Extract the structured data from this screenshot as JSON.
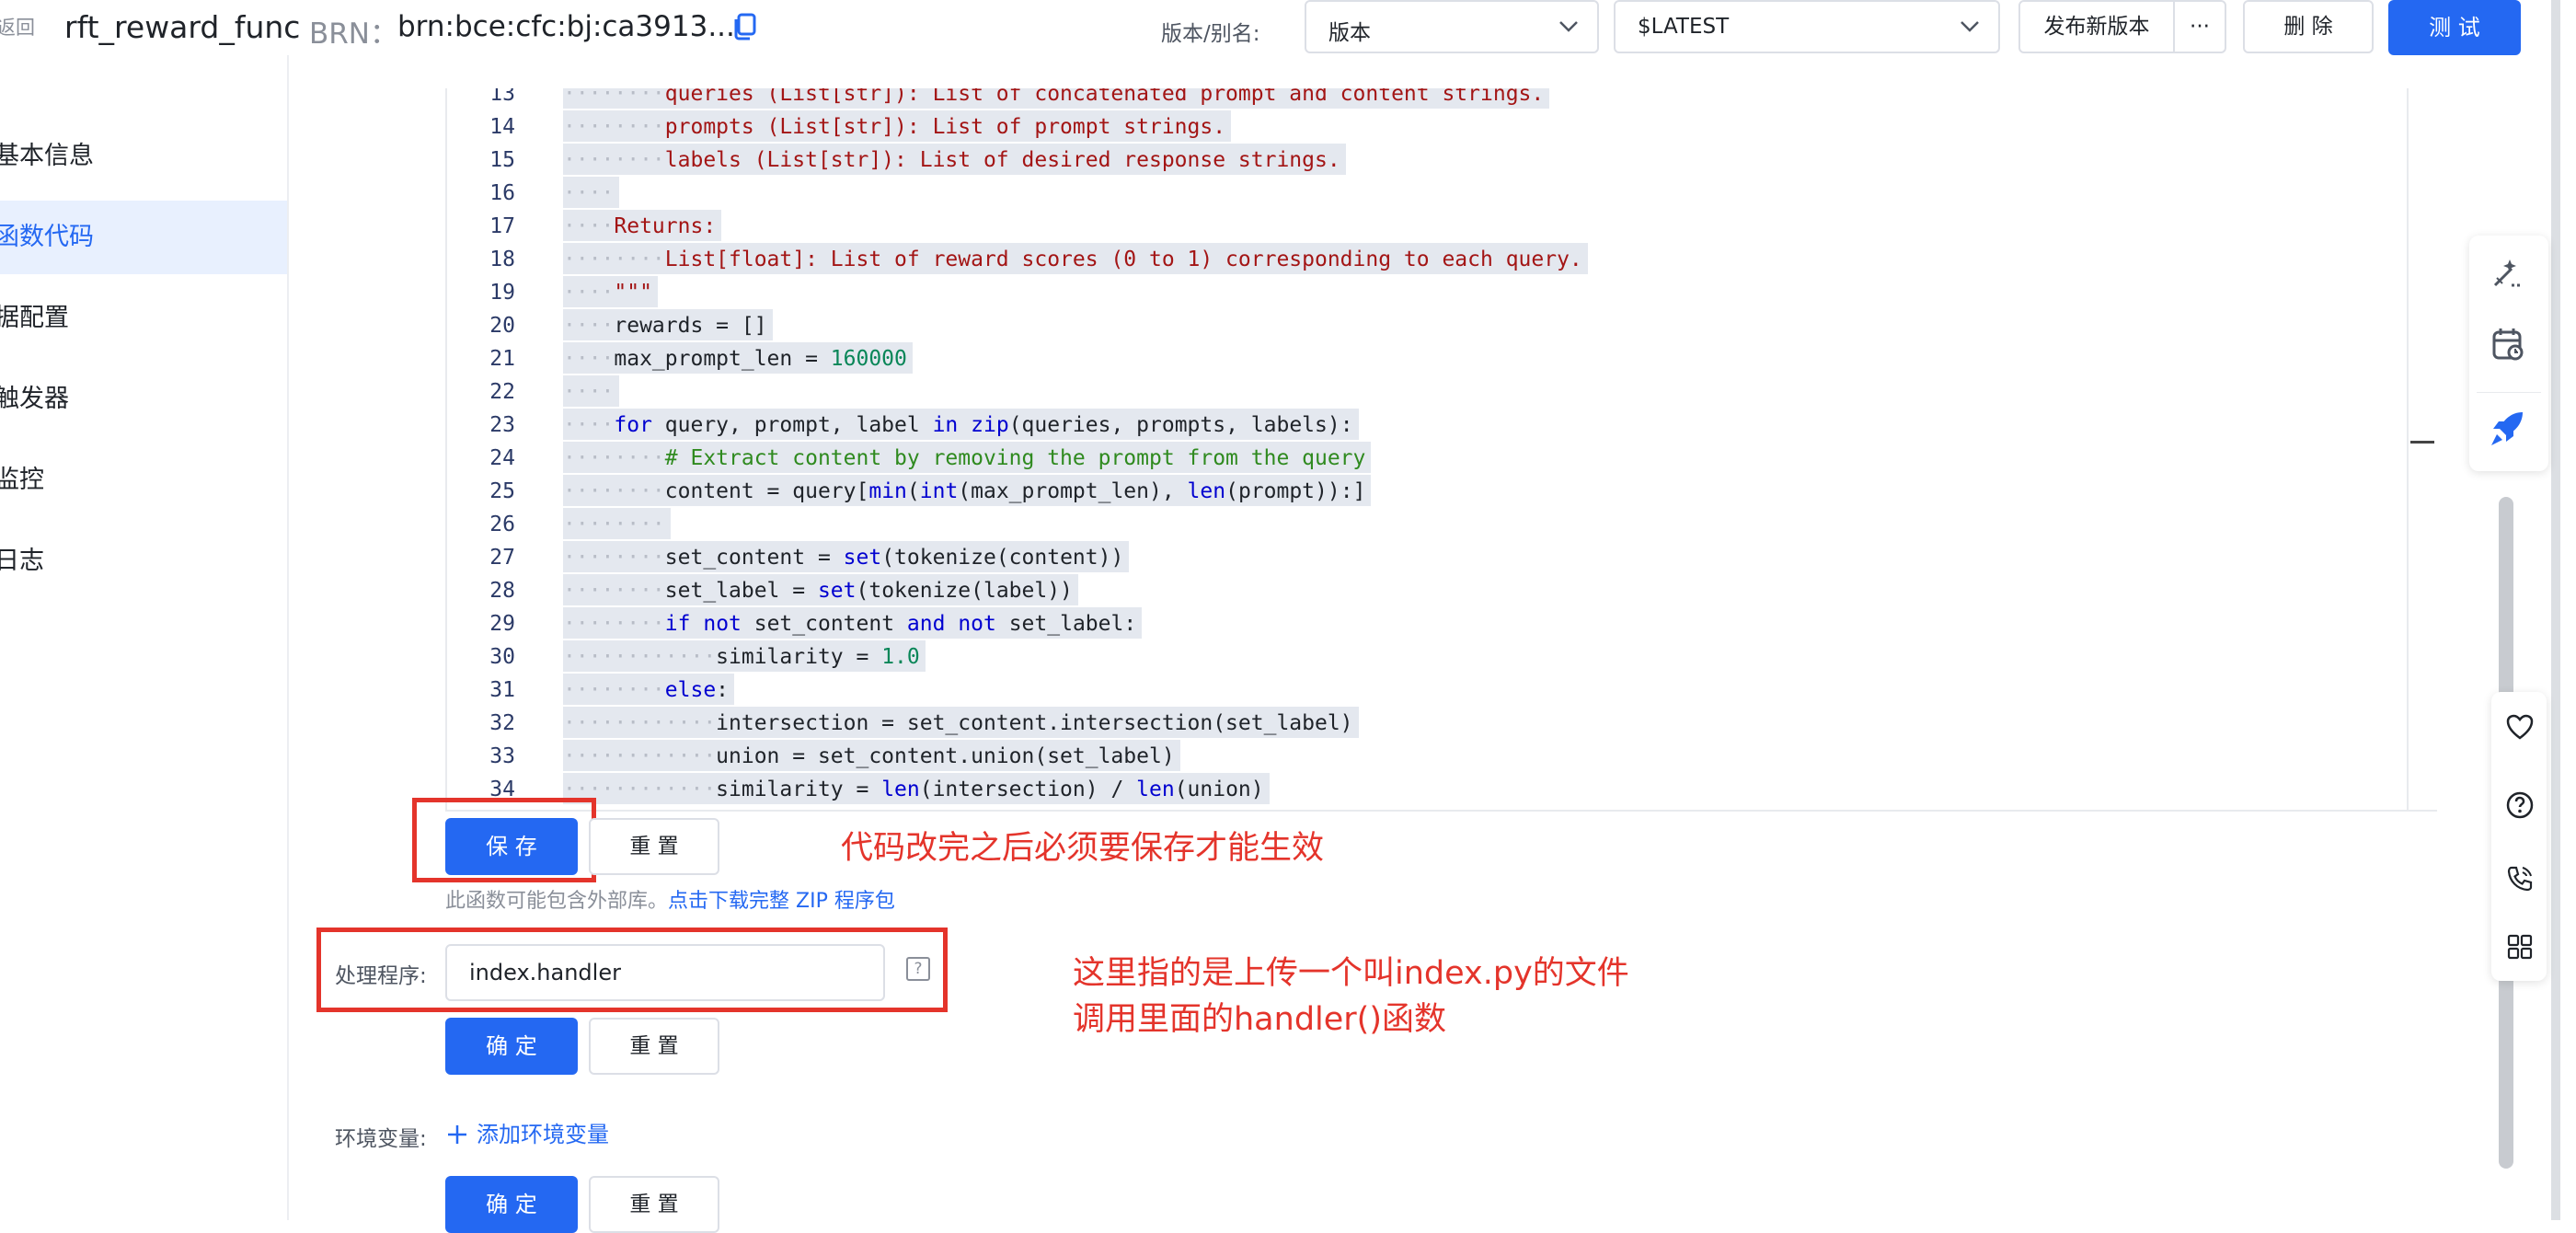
{
  "header": {
    "back_label": "返回",
    "function_name": "rft_reward_func",
    "brn_label": "BRN：",
    "brn_value": "brn:bce:cfc:bj:ca3913...",
    "version_alias_label": "版本/别名:",
    "version_select": "版本",
    "alias_select": "$LATEST",
    "publish_button": "发布新版本",
    "more_button": "···",
    "delete_button": "删 除",
    "test_button": "测 试"
  },
  "sidebar": {
    "items": [
      {
        "label": "基本信息",
        "active": false
      },
      {
        "label": "函数代码",
        "active": true
      },
      {
        "label": "据配置",
        "active": false
      },
      {
        "label": "触发器",
        "active": false
      },
      {
        "label": "监控",
        "active": false
      },
      {
        "label": "日志",
        "active": false
      }
    ]
  },
  "code_lines": [
    {
      "n": "13",
      "html": "<span class=\"tok-ws\">········</span><span class=\"tok-str\">queries (List[str]): List of concatenated prompt and content strings.</span>"
    },
    {
      "n": "14",
      "html": "<span class=\"tok-ws\">········</span><span class=\"tok-str\">prompts (List[str]): List of prompt strings.</span>"
    },
    {
      "n": "15",
      "html": "<span class=\"tok-ws\">········</span><span class=\"tok-str\">labels (List[str]): List of desired response strings.</span>"
    },
    {
      "n": "16",
      "html": "<span class=\"tok-ws\">····</span>"
    },
    {
      "n": "17",
      "html": "<span class=\"tok-ws\">····</span><span class=\"tok-str\">Returns:</span>"
    },
    {
      "n": "18",
      "html": "<span class=\"tok-ws\">········</span><span class=\"tok-str\">List[float]: List of reward scores (0 to 1) corresponding to each query.</span>"
    },
    {
      "n": "19",
      "html": "<span class=\"tok-ws\">····</span><span class=\"tok-str\">\"\"\"</span>"
    },
    {
      "n": "20",
      "html": "<span class=\"tok-ws\">····</span>rewards = []"
    },
    {
      "n": "21",
      "html": "<span class=\"tok-ws\">····</span>max_prompt_len = <span class=\"tok-num\">160000</span>"
    },
    {
      "n": "22",
      "html": "<span class=\"tok-ws\">····</span>"
    },
    {
      "n": "23",
      "html": "<span class=\"tok-ws\">····</span><span class=\"tok-kw\">for</span> query, prompt, label <span class=\"tok-kw\">in</span> <span class=\"tok-kw\">zip</span>(queries, prompts, labels):"
    },
    {
      "n": "24",
      "html": "<span class=\"tok-ws\">········</span><span class=\"tok-cm\"># Extract content by removing the prompt from the query</span>"
    },
    {
      "n": "25",
      "html": "<span class=\"tok-ws\">········</span>content = query[<span class=\"tok-kw\">min</span>(<span class=\"tok-kw\">int</span>(max_prompt_len), <span class=\"tok-kw\">len</span>(prompt)):]"
    },
    {
      "n": "26",
      "html": "<span class=\"tok-ws\">········</span>"
    },
    {
      "n": "27",
      "html": "<span class=\"tok-ws\">········</span>set_content = <span class=\"tok-kw\">set</span>(tokenize(content))"
    },
    {
      "n": "28",
      "html": "<span class=\"tok-ws\">········</span>set_label = <span class=\"tok-kw\">set</span>(tokenize(label))"
    },
    {
      "n": "29",
      "html": "<span class=\"tok-ws\">········</span><span class=\"tok-kw\">if</span> <span class=\"tok-kw\">not</span> set_content <span class=\"tok-kw\">and</span> <span class=\"tok-kw\">not</span> set_label:"
    },
    {
      "n": "30",
      "html": "<span class=\"tok-ws\">············</span>similarity = <span class=\"tok-num\">1.0</span>"
    },
    {
      "n": "31",
      "html": "<span class=\"tok-ws\">········</span><span class=\"tok-kw\">else</span>:"
    },
    {
      "n": "32",
      "html": "<span class=\"tok-ws\">············</span>intersection = set_content.intersection(set_label)"
    },
    {
      "n": "33",
      "html": "<span class=\"tok-ws\">············</span>union = set_content.union(set_label)"
    },
    {
      "n": "34",
      "html": "<span class=\"tok-ws\">············</span>similarity = <span class=\"tok-kw\">len</span>(intersection) / <span class=\"tok-kw\">len</span>(union)"
    }
  ],
  "code_actions": {
    "save_button": "保 存",
    "reset_button": "重 置"
  },
  "annotations": {
    "save_note": "代码改完之后必须要保存才能生效",
    "handler_note_line1": "这里指的是上传一个叫index.py的文件",
    "handler_note_line2": "调用里面的handler()函数"
  },
  "hint": {
    "text": "此函数可能包含外部库。",
    "link": "点击下载完整 ZIP 程序包"
  },
  "handler": {
    "label": "处理程序:",
    "value": "index.handler",
    "help_icon": "?",
    "confirm_button": "确 定",
    "reset_button": "重 置"
  },
  "env": {
    "label": "环境变量:",
    "add_link": "添加环境变量",
    "confirm_button": "确 定",
    "reset_button": "重 置"
  },
  "colors": {
    "primary": "#2468f2",
    "annotation_red": "#e4342b"
  }
}
